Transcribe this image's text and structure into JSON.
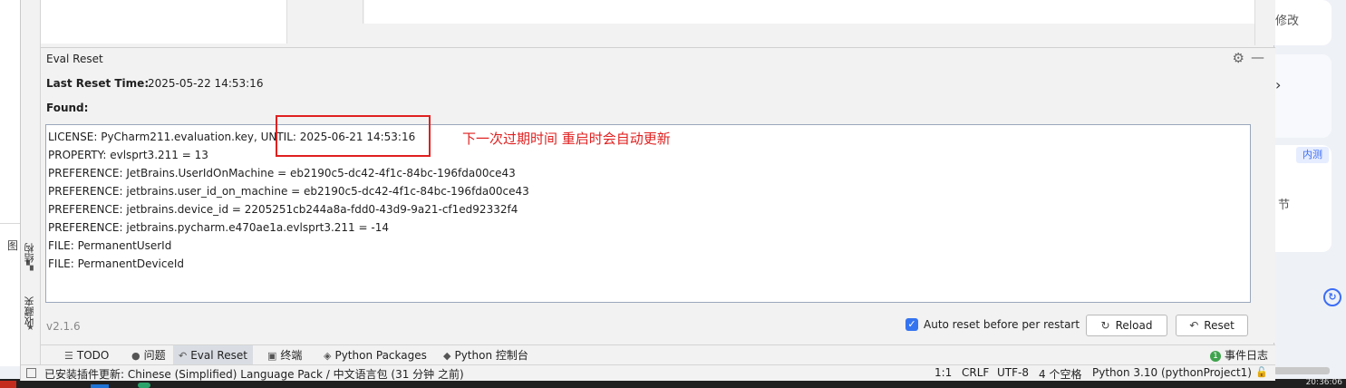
{
  "background": {
    "left_char": "图",
    "right_texts": [
      "修改",
      "节"
    ],
    "badge": "内测",
    "clock": "20:36:06"
  },
  "side_stripe": {
    "tab_structure": "结构",
    "tab_favorites": "收藏夹"
  },
  "tool_window": {
    "title": "Eval Reset",
    "last_reset_label": "Last Reset Time:",
    "last_reset_value": "2025-05-22 14:53:16",
    "found_label": "Found:",
    "items": [
      "LICENSE: PyCharm211.evaluation.key, UNTIL: 2025-06-21 14:53:16",
      "PROPERTY: evlsprt3.211 = 13",
      "PREFERENCE: JetBrains.UserIdOnMachine = eb2190c5-dc42-4f1c-84bc-196fda00ce43",
      "PREFERENCE: jetbrains.user_id_on_machine = eb2190c5-dc42-4f1c-84bc-196fda00ce43",
      "PREFERENCE: jetbrains.device_id = 2205251cb244a8a-fdd0-43d9-9a21-cf1ed92332f4",
      "PREFERENCE: jetbrains.pycharm.e470ae1a.evlsprt3.211 = -14",
      "FILE: PermanentUserId",
      "FILE: PermanentDeviceId"
    ],
    "version": "v2.1.6",
    "auto_reset_label": "Auto reset before per restart",
    "auto_reset_checked": true,
    "reload_label": "Reload",
    "reset_label": "Reset"
  },
  "annotation": {
    "text": "下一次过期时间 重启时会自动更新",
    "color": "#e02020"
  },
  "bottom_tabs": [
    {
      "label": "TODO",
      "icon": "list-icon"
    },
    {
      "label": "问题",
      "icon": "info-icon"
    },
    {
      "label": "Eval Reset",
      "icon": "reset-icon",
      "active": true
    },
    {
      "label": "终端",
      "icon": "terminal-icon"
    },
    {
      "label": "Python Packages",
      "icon": "packages-icon"
    },
    {
      "label": "Python 控制台",
      "icon": "python-icon"
    }
  ],
  "event_log": {
    "label": "事件日志",
    "count": "1"
  },
  "status_bar": {
    "message": "已安装插件更新: Chinese (Simplified) Language Pack / 中文语言包 (31 分钟 之前)",
    "position": "1:1",
    "line_sep": "CRLF",
    "encoding": "UTF-8",
    "indent": "4 个空格",
    "interpreter": "Python 3.10 (pythonProject1)"
  },
  "colors": {
    "accent": "#3574f0",
    "annotation": "#e02020",
    "active_tab": "#d9dde3"
  }
}
